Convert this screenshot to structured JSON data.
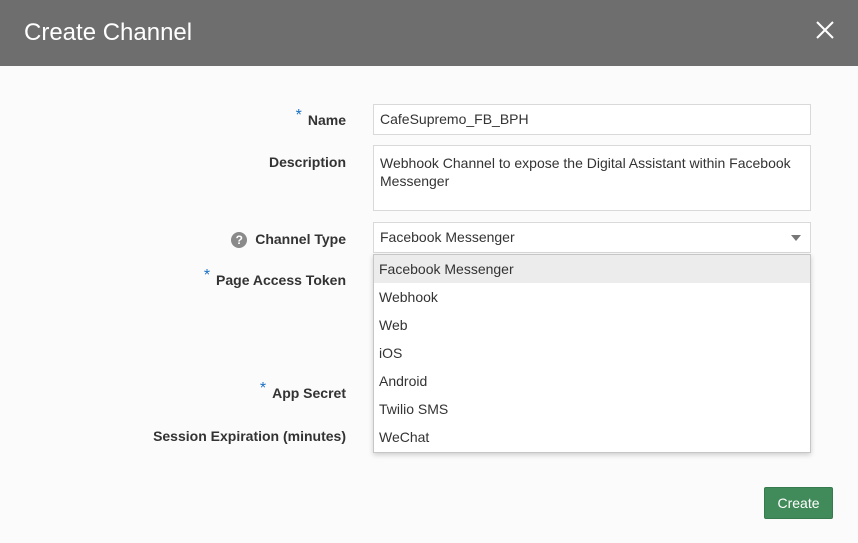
{
  "dialog": {
    "title": "Create Channel",
    "close_icon": "close-icon"
  },
  "form": {
    "name": {
      "label": "Name",
      "required_mark": "*",
      "value": "CafeSupremo_FB_BPH"
    },
    "description": {
      "label": "Description",
      "value": "Webhook Channel to expose the Digital Assistant within Facebook Messenger"
    },
    "channel_type": {
      "label": "Channel Type",
      "help_icon": "help-icon",
      "help_glyph": "?",
      "value": "Facebook Messenger",
      "options": [
        "Facebook Messenger",
        "Webhook",
        "Web",
        "iOS",
        "Android",
        "Twilio SMS",
        "WeChat"
      ]
    },
    "page_access_token": {
      "label": "Page Access Token",
      "required_mark": "*"
    },
    "app_secret": {
      "label": "App Secret",
      "required_mark": "*"
    },
    "session_expiration": {
      "label": "Session Expiration (minutes)"
    }
  },
  "footer": {
    "create_label": "Create"
  },
  "colors": {
    "titlebar": "#6e6e6e",
    "required": "#1a6fc4",
    "primary_button": "#418b5a"
  }
}
